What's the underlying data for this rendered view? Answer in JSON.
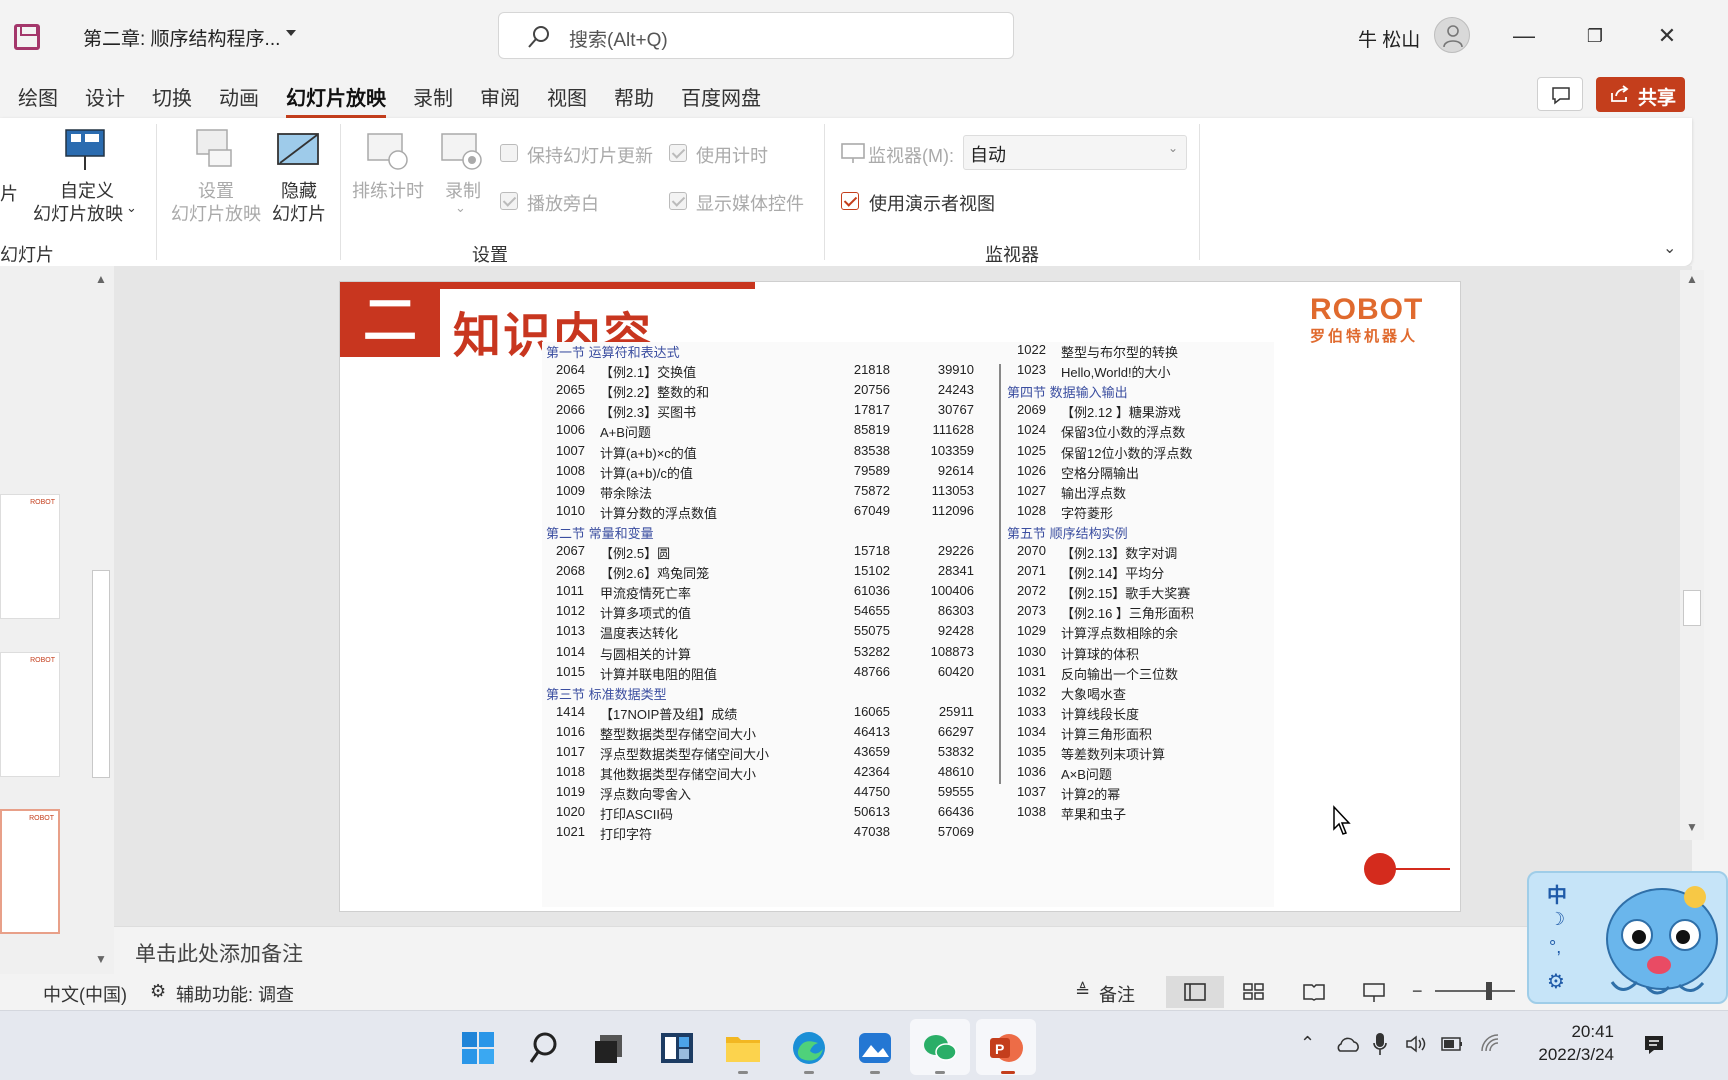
{
  "titlebar": {
    "doc_title": "第二章: 顺序结构程序...",
    "search_placeholder": "搜索(Alt+Q)",
    "user_name": "牛 松山",
    "minimize": "—",
    "restore": "❐",
    "close": "✕"
  },
  "tabs": [
    "绘图",
    "设计",
    "切换",
    "动画",
    "幻灯片放映",
    "录制",
    "审阅",
    "视图",
    "帮助",
    "百度网盘"
  ],
  "active_tab": "幻灯片放映",
  "share_label": "共享",
  "ribbon": {
    "left_cut": "片",
    "custom_show": [
      "自定义",
      "幻灯片放映"
    ],
    "setup_show": [
      "设置",
      "幻灯片放映"
    ],
    "hide_slide": [
      "隐藏",
      "幻灯片"
    ],
    "rehearse": "排练计时",
    "record": "录制",
    "keep_updated": "保持幻灯片更新",
    "use_timings": "使用计时",
    "play_narration": "播放旁白",
    "show_media": "显示媒体控件",
    "monitor_label": "监视器(M):",
    "monitor_value": "自动",
    "presenter_view": "使用演示者视图",
    "group_slides": "幻灯片",
    "group_setup": "设置",
    "group_monitor": "监视器"
  },
  "slide": {
    "badge_num": "二",
    "heading": "知识内容",
    "logo_main": "ROBOT",
    "logo_sub": "罗伯特机器人",
    "left_sections": [
      {
        "title": "第一节 运算符和表达式",
        "rows": [
          [
            "2064",
            "【例2.1】交换值",
            "21818",
            "39910"
          ],
          [
            "2065",
            "【例2.2】整数的和",
            "20756",
            "24243"
          ],
          [
            "2066",
            "【例2.3】买图书",
            "17817",
            "30767"
          ],
          [
            "1006",
            "A+B问题",
            "85819",
            "111628"
          ],
          [
            "1007",
            "计算(a+b)×c的值",
            "83538",
            "103359"
          ],
          [
            "1008",
            "计算(a+b)/c的值",
            "79589",
            "92614"
          ],
          [
            "1009",
            "带余除法",
            "75872",
            "113053"
          ],
          [
            "1010",
            "计算分数的浮点数值",
            "67049",
            "112096"
          ]
        ]
      },
      {
        "title": "第二节 常量和变量",
        "rows": [
          [
            "2067",
            "【例2.5】圆",
            "15718",
            "29226"
          ],
          [
            "2068",
            "【例2.6】鸡兔同笼",
            "15102",
            "28341"
          ],
          [
            "1011",
            "甲流疫情死亡率",
            "61036",
            "100406"
          ],
          [
            "1012",
            "计算多项式的值",
            "54655",
            "86303"
          ],
          [
            "1013",
            "温度表达转化",
            "55075",
            "92428"
          ],
          [
            "1014",
            "与圆相关的计算",
            "53282",
            "108873"
          ],
          [
            "1015",
            "计算并联电阻的阻值",
            "48766",
            "60420"
          ]
        ]
      },
      {
        "title": "第三节 标准数据类型",
        "rows": [
          [
            "1414",
            "【17NOIP普及组】成绩",
            "16065",
            "25911"
          ],
          [
            "1016",
            "整型数据类型存储空间大小",
            "46413",
            "66297"
          ],
          [
            "1017",
            "浮点型数据类型存储空间大小",
            "43659",
            "53832"
          ],
          [
            "1018",
            "其他数据类型存储空间大小",
            "42364",
            "48610"
          ],
          [
            "1019",
            "浮点数向零舍入",
            "44750",
            "59555"
          ],
          [
            "1020",
            "打印ASCII码",
            "50613",
            "66436"
          ],
          [
            "1021",
            "打印字符",
            "47038",
            "57069"
          ]
        ]
      }
    ],
    "right_sections": [
      {
        "title": "",
        "rows": [
          [
            "1022",
            "整型与布尔型的转换"
          ],
          [
            "1023",
            "Hello,World!的大小"
          ]
        ]
      },
      {
        "title": "第四节 数据输入输出",
        "rows": [
          [
            "2069",
            "【例2.12 】糖果游戏"
          ],
          [
            "1024",
            "保留3位小数的浮点数"
          ],
          [
            "1025",
            "保留12位小数的浮点数"
          ],
          [
            "1026",
            "空格分隔输出"
          ],
          [
            "1027",
            "输出浮点数"
          ],
          [
            "1028",
            "字符菱形"
          ]
        ]
      },
      {
        "title": "第五节 顺序结构实例",
        "rows": [
          [
            "2070",
            "【例2.13】数字对调"
          ],
          [
            "2071",
            "【例2.14】平均分"
          ],
          [
            "2072",
            "【例2.15】歌手大奖赛"
          ],
          [
            "2073",
            "【例2.16 】三角形面积"
          ],
          [
            "1029",
            "计算浮点数相除的余"
          ],
          [
            "1030",
            "计算球的体积"
          ],
          [
            "1031",
            "反向输出一个三位数"
          ],
          [
            "1032",
            "大象喝水查"
          ],
          [
            "1033",
            "计算线段长度"
          ],
          [
            "1034",
            "计算三角形面积"
          ],
          [
            "1035",
            "等差数列末项计算"
          ],
          [
            "1036",
            "A×B问题"
          ],
          [
            "1037",
            "计算2的幂"
          ],
          [
            "1038",
            "苹果和虫子"
          ]
        ]
      }
    ]
  },
  "notes_placeholder": "单击此处添加备注",
  "statusbar": {
    "language": "中文(中国)",
    "accessibility": "辅助功能: 调查",
    "notes_btn": "备注"
  },
  "mascot_labels": [
    "中",
    "☽",
    "°,",
    "⚙"
  ],
  "clock": {
    "time": "20:41",
    "date": "2022/3/24"
  },
  "thumb_logo": "ROBOT",
  "colors": {
    "accent": "#c43e1c",
    "slide_red": "#c8361f",
    "section_blue": "#3b4ea0"
  }
}
